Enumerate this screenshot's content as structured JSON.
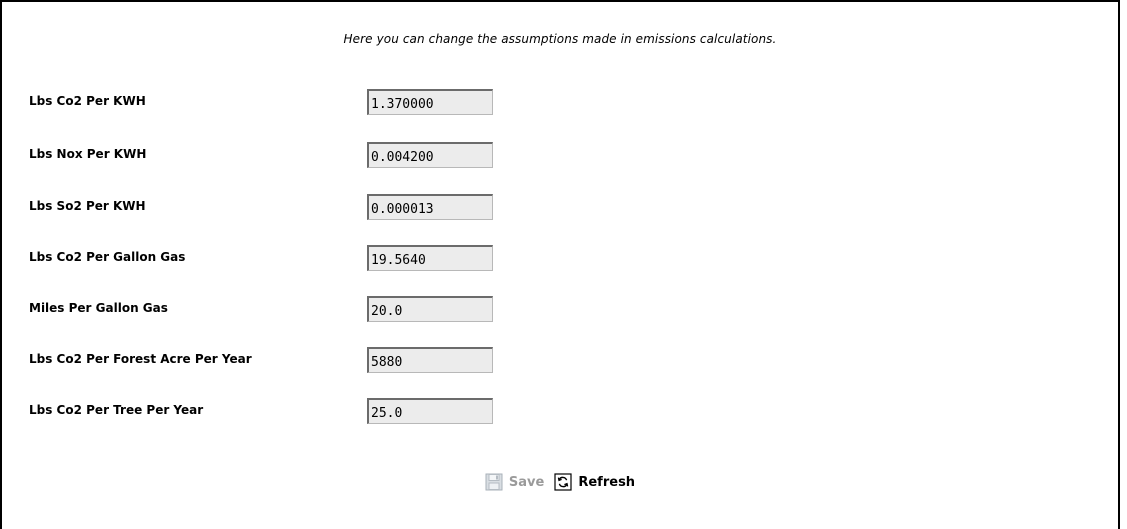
{
  "intro_text": "Here you can change the assumptions made in emissions calculations.",
  "fields": [
    {
      "label": "Lbs Co2 Per KWH",
      "value": "1.370000"
    },
    {
      "label": "Lbs Nox Per KWH",
      "value": "0.004200"
    },
    {
      "label": "Lbs So2 Per KWH",
      "value": "0.000013"
    },
    {
      "label": "Lbs Co2 Per Gallon Gas",
      "value": "19.5640"
    },
    {
      "label": "Miles Per Gallon Gas",
      "value": "20.0"
    },
    {
      "label": "Lbs Co2 Per Forest Acre Per Year",
      "value": "5880"
    },
    {
      "label": "Lbs Co2 Per Tree Per Year",
      "value": "25.0"
    }
  ],
  "actions": {
    "save_label": "Save",
    "save_icon": "floppy-disk-icon",
    "save_state": "disabled",
    "refresh_label": "Refresh",
    "refresh_icon": "refresh-icon"
  },
  "colors": {
    "field_background": "#ececec",
    "disabled_text": "#9a9a9a"
  }
}
